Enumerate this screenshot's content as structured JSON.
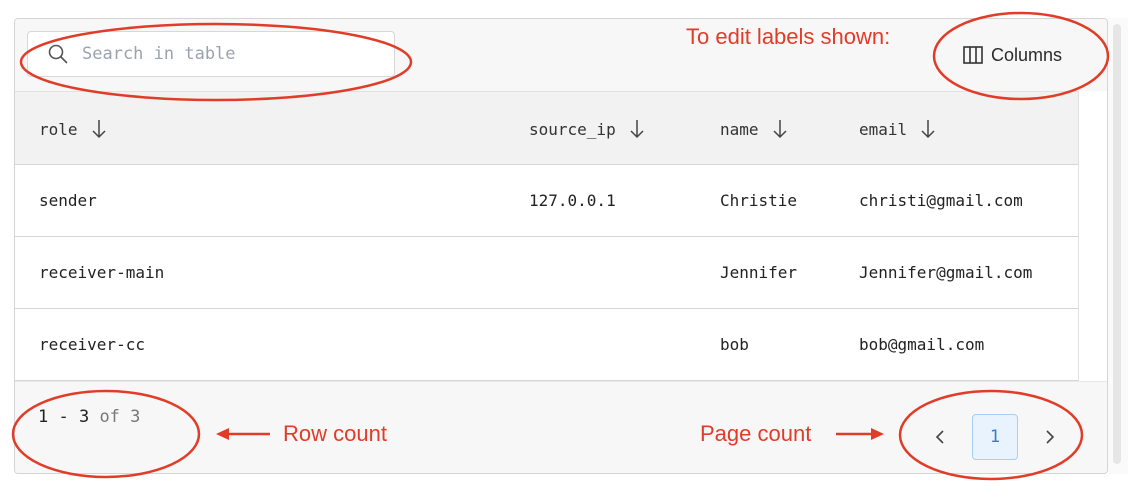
{
  "search": {
    "placeholder": "Search in table",
    "icon": "search-icon"
  },
  "toolbar": {
    "edit_hint": "To edit labels shown:",
    "columns_label": "Columns",
    "columns_icon": "columns-icon"
  },
  "table": {
    "headers": [
      {
        "label": "role",
        "sort_icon": "arrow-down-icon"
      },
      {
        "label": "source_ip",
        "sort_icon": "arrow-down-icon"
      },
      {
        "label": "name",
        "sort_icon": "arrow-down-icon"
      },
      {
        "label": "email",
        "sort_icon": "arrow-down-icon"
      }
    ],
    "rows": [
      {
        "role": "sender",
        "source_ip": "127.0.0.1",
        "name": "Christie",
        "email": "christi@gmail.com"
      },
      {
        "role": "receiver-main",
        "source_ip": "",
        "name": "Jennifer",
        "email": "Jennifer@gmail.com"
      },
      {
        "role": "receiver-cc",
        "source_ip": "",
        "name": "bob",
        "email": "bob@gmail.com"
      }
    ]
  },
  "footer": {
    "range": "1 - 3",
    "of_label": "of 3",
    "row_count_annotation": "Row count",
    "page_count_annotation": "Page count",
    "current_page": "1",
    "prev_icon": "chevron-left-icon",
    "next_icon": "chevron-right-icon"
  },
  "colors": {
    "annotation": "#e03c28",
    "page_active_bg": "#e8f3fe",
    "page_active_text": "#2f7fd6"
  }
}
